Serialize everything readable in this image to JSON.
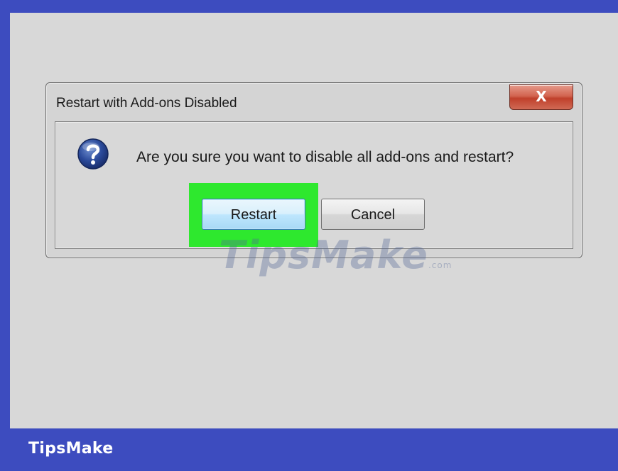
{
  "dialog": {
    "title": "Restart with Add-ons Disabled",
    "close_label": "X",
    "message": "Are you sure you want to disable all add-ons and restart?",
    "restart_label": "Restart",
    "cancel_label": "Cancel",
    "icon": "question-icon"
  },
  "watermark": {
    "text": "TipsMake",
    "suffix": ".com"
  },
  "footer": {
    "brand": "TipsMake"
  },
  "colors": {
    "frame": "#3d4cbf",
    "screen": "#d8d8d8",
    "highlight": "#2ee82e",
    "close_button": "#c0402b"
  }
}
